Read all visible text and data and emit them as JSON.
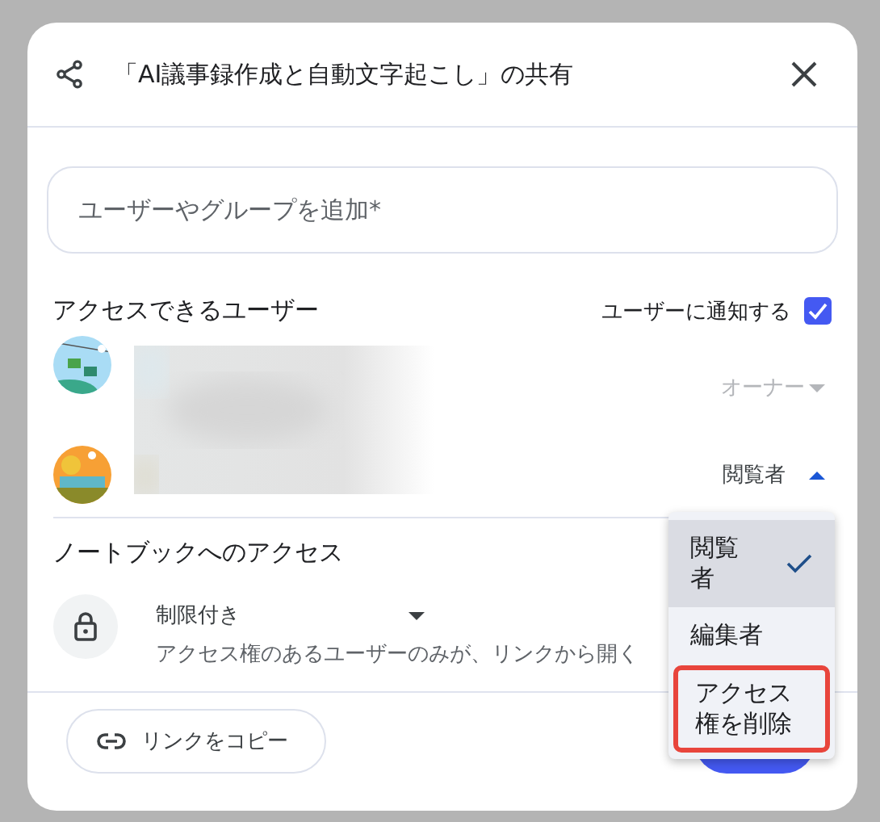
{
  "dialog": {
    "title": "「AI議事録作成と自動文字起こし」の共有",
    "add_field": {
      "placeholder": "ユーザーやグループを追加*"
    },
    "users_heading": "アクセスできるユーザー",
    "notify": {
      "label": "ユーザーに通知する",
      "checked": true
    },
    "users": [
      {
        "role": "オーナー",
        "disabled": true,
        "expanded": false
      },
      {
        "role": "閲覧者",
        "disabled": false,
        "expanded": true
      }
    ],
    "notebook_access": {
      "heading": "ノートブックへのアクセス",
      "mode": "制限付き",
      "description": "アクセス権のあるユーザーのみが、リンクから開く"
    },
    "copy_link": "リンクをコピー",
    "role_menu": [
      {
        "label": "閲覧者",
        "selected": true,
        "highlighted": false
      },
      {
        "label": "編集者",
        "selected": false,
        "highlighted": false
      },
      {
        "label": "アクセス権を削除",
        "selected": false,
        "highlighted": true
      }
    ]
  }
}
